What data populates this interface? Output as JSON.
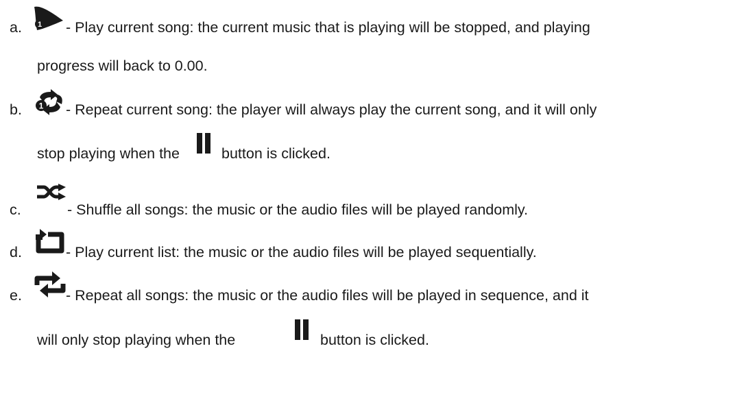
{
  "items": [
    {
      "letter": "a.",
      "icon": "play-one-icon",
      "line1": "- Play current song: the current music that is playing will be stopped, and playing",
      "line2": "progress will back to 0.00."
    },
    {
      "letter": "b.",
      "icon": "repeat-one-icon",
      "line1": "- Repeat current song: the player will always play the current song, and it will only",
      "line2_pre": "stop playing when the",
      "line2_icon": "pause-icon",
      "line2_post": "button is clicked."
    },
    {
      "letter": "c.",
      "icon": "shuffle-icon",
      "line1": "- Shuffle all songs: the music or the audio files will be played randomly."
    },
    {
      "letter": "d.",
      "icon": "play-list-icon",
      "line1": "- Play current list: the music or the audio files will be played sequentially."
    },
    {
      "letter": "e.",
      "icon": "repeat-all-icon",
      "line1": "- Repeat all songs: the music or the audio files will be played in sequence, and it",
      "line2_pre": "will only stop playing when the",
      "line2_icon": "pause-icon",
      "line2_post": "button is clicked."
    }
  ],
  "colors": {
    "text": "#1a1a1a",
    "icon": "#1a1a1a"
  }
}
